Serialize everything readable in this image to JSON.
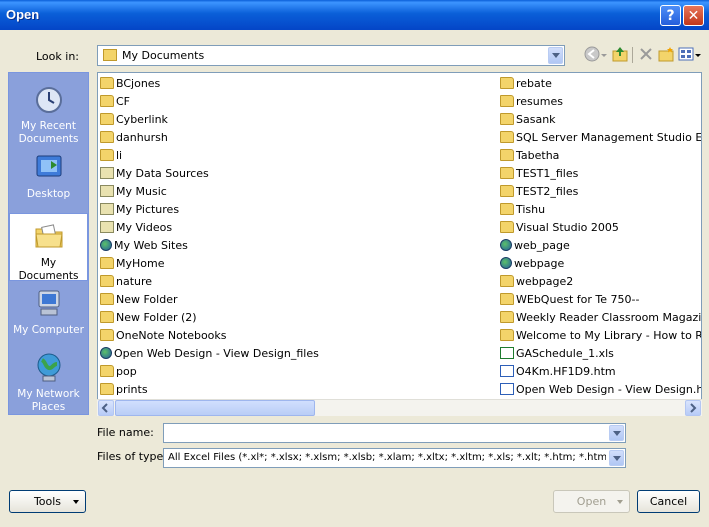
{
  "window": {
    "title": "Open"
  },
  "lookin": {
    "label": "Look in:",
    "value": "My Documents"
  },
  "places": [
    {
      "name": "place-my-recent-documents",
      "line1": "My Recent",
      "line2": "Documents"
    },
    {
      "name": "place-desktop",
      "line1": "Desktop",
      "line2": ""
    },
    {
      "name": "place-my-documents",
      "line1": "My Documents",
      "line2": ""
    },
    {
      "name": "place-my-computer",
      "line1": "My Computer",
      "line2": ""
    },
    {
      "name": "place-my-network-places",
      "line1": "My Network",
      "line2": "Places"
    }
  ],
  "files_col1": [
    {
      "label": "BCjones",
      "icon": "folder"
    },
    {
      "label": "CF",
      "icon": "folder"
    },
    {
      "label": "Cyberlink",
      "icon": "folder"
    },
    {
      "label": "danhursh",
      "icon": "folder"
    },
    {
      "label": "li",
      "icon": "folder"
    },
    {
      "label": "My Data Sources",
      "icon": "special"
    },
    {
      "label": "My Music",
      "icon": "special"
    },
    {
      "label": "My Pictures",
      "icon": "special"
    },
    {
      "label": "My Videos",
      "icon": "special"
    },
    {
      "label": "My Web Sites",
      "icon": "globe"
    },
    {
      "label": "MyHome",
      "icon": "folder"
    },
    {
      "label": "nature",
      "icon": "folder"
    },
    {
      "label": "New Folder",
      "icon": "folder"
    },
    {
      "label": "New Folder (2)",
      "icon": "folder"
    },
    {
      "label": "OneNote Notebooks",
      "icon": "folder"
    },
    {
      "label": "Open Web Design - View Design_files",
      "icon": "globe"
    },
    {
      "label": "pop",
      "icon": "folder"
    },
    {
      "label": "prints",
      "icon": "folder"
    }
  ],
  "files_col2": [
    {
      "label": "rebate",
      "icon": "folder"
    },
    {
      "label": "resumes",
      "icon": "folder"
    },
    {
      "label": "Sasank",
      "icon": "folder"
    },
    {
      "label": "SQL Server Management Studio Express",
      "icon": "folder"
    },
    {
      "label": "Tabetha",
      "icon": "folder"
    },
    {
      "label": "TEST1_files",
      "icon": "folder"
    },
    {
      "label": "TEST2_files",
      "icon": "folder"
    },
    {
      "label": "Tishu",
      "icon": "folder"
    },
    {
      "label": "Visual Studio 2005",
      "icon": "folder"
    },
    {
      "label": "web_page",
      "icon": "globe"
    },
    {
      "label": "webpage",
      "icon": "globe"
    },
    {
      "label": "webpage2",
      "icon": "folder"
    },
    {
      "label": "WEbQuest for Te 750--",
      "icon": "folder"
    },
    {
      "label": "Weekly Reader Classroom Magazines and I",
      "icon": "folder"
    },
    {
      "label": "Welcome to My Library - How to Read a Nu",
      "icon": "folder"
    },
    {
      "label": "GASchedule_1.xls",
      "icon": "xls"
    },
    {
      "label": "O4Km.HF1D9.htm",
      "icon": "htm"
    },
    {
      "label": "Open Web Design - View Design.htm",
      "icon": "htm"
    }
  ],
  "filename": {
    "label": "File name:",
    "value": ""
  },
  "filetype": {
    "label": "Files of type:",
    "value": "All Excel Files (*.xl*; *.xlsx; *.xlsm; *.xlsb; *.xlam; *.xltx; *.xltm; *.xls; *.xlt; *.htm; *.html; *.mht; *"
  },
  "buttons": {
    "tools": "Tools",
    "open": "Open",
    "cancel": "Cancel"
  }
}
